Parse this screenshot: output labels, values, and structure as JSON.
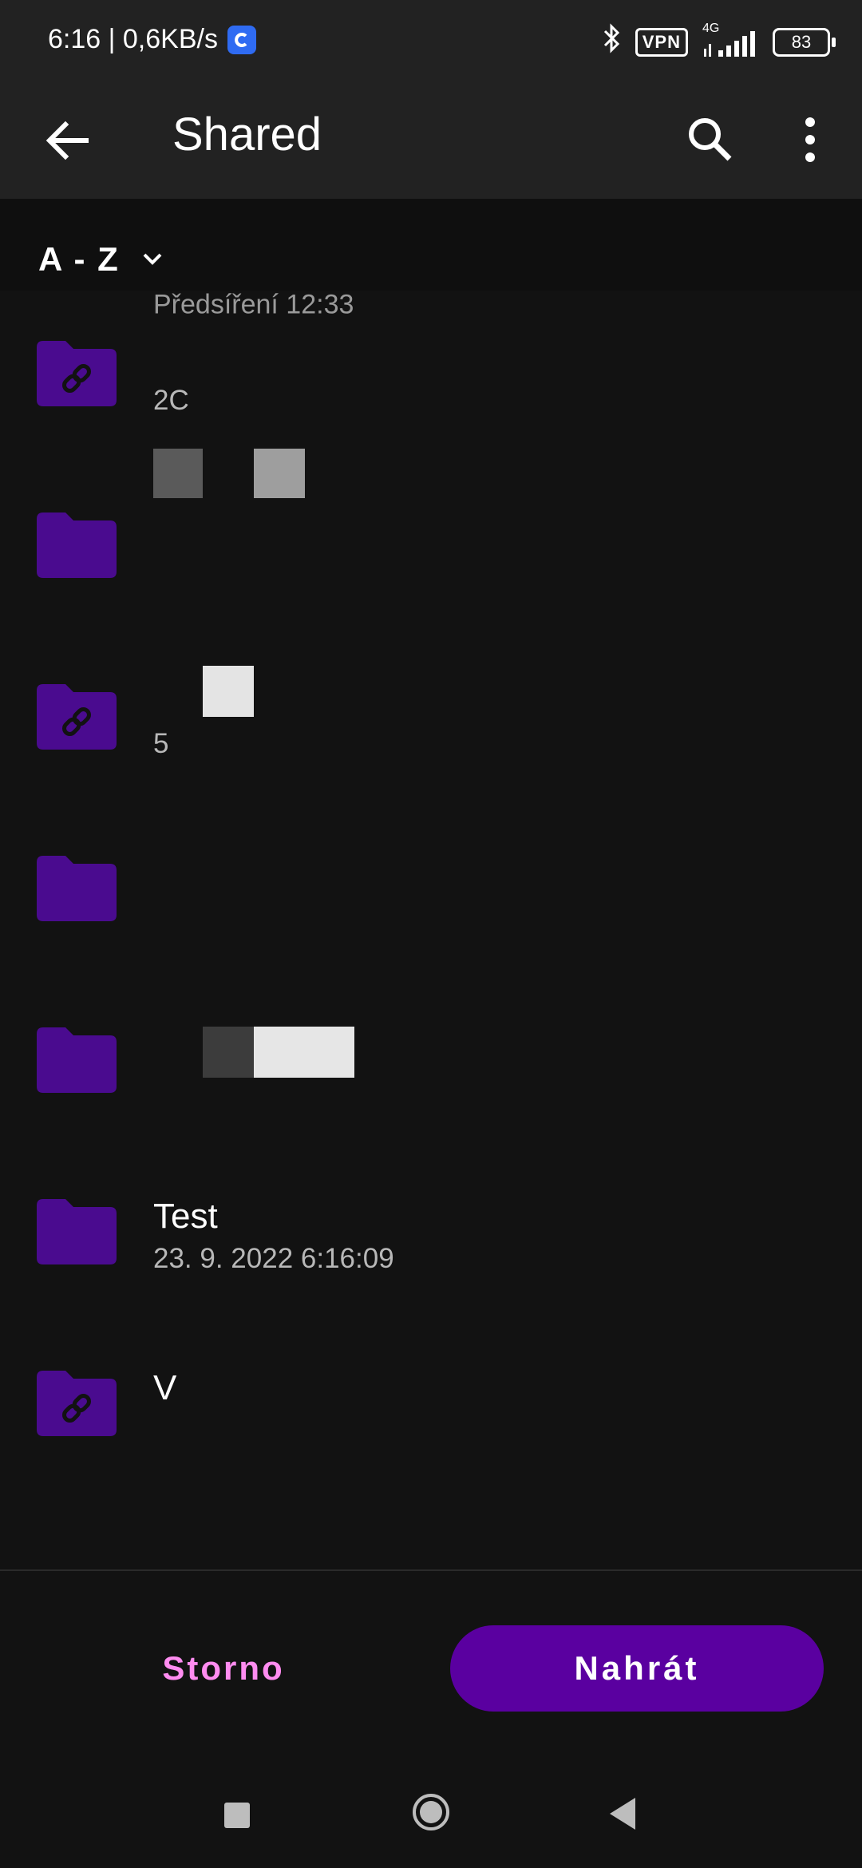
{
  "status_bar": {
    "time_speed": "6:16 | 0,6KB/s",
    "vpn": "VPN",
    "network": "4G",
    "battery": "83"
  },
  "app_bar": {
    "title": "Shared",
    "back_icon": "arrow-left-icon",
    "search_icon": "search-icon",
    "menu_icon": "more-vert-icon"
  },
  "sort": {
    "label": "A - Z"
  },
  "list": {
    "peek_text": "Předsíření 12:33",
    "items": [
      {
        "name": "",
        "date": "2C",
        "type": "shared-folder"
      },
      {
        "name": "",
        "date": "",
        "type": "folder"
      },
      {
        "name": "",
        "date": "5",
        "type": "shared-folder"
      },
      {
        "name": "",
        "date": "",
        "type": "folder"
      },
      {
        "name": "",
        "date": "",
        "type": "folder"
      },
      {
        "name": "Test",
        "date": "23. 9. 2022 6:16:09",
        "type": "folder"
      },
      {
        "name": "V",
        "date": "",
        "type": "shared-folder"
      }
    ]
  },
  "actions": {
    "cancel_label": "Storno",
    "upload_label": "Nahrát"
  },
  "colors": {
    "accent": "#5a00a0",
    "folder": "#4a0b8f",
    "cancel_text": "#ff8cf0"
  }
}
